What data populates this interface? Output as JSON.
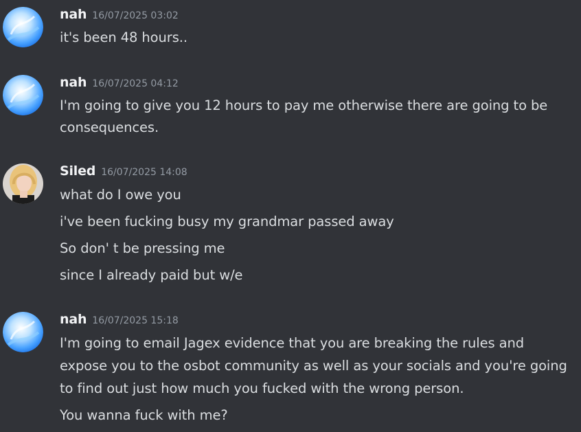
{
  "messages": [
    {
      "author": "nah",
      "timestamp": "16/07/2025 03:02",
      "avatar": "blue-swirl-avatar",
      "lines": [
        "it's been 48 hours.."
      ]
    },
    {
      "author": "nah",
      "timestamp": "16/07/2025 04:12",
      "avatar": "blue-swirl-avatar",
      "lines": [
        "I'm going to give you 12 hours to pay me otherwise there are going to be consequences."
      ]
    },
    {
      "author": "Siled",
      "timestamp": "16/07/2025 14:08",
      "avatar": "portrait-avatar",
      "lines": [
        "what do I owe you",
        "i've been fucking busy my grandmar passed away",
        "So don' t be pressing me",
        "since I already paid but w/e"
      ]
    },
    {
      "author": "nah",
      "timestamp": "16/07/2025 15:18",
      "avatar": "blue-swirl-avatar",
      "lines": [
        "I'm going to email Jagex evidence that you are breaking the rules and expose you to the osbot community as well as your socials and you're going to find out just how much you fucked with the wrong person.",
        "You wanna fuck with me?"
      ]
    }
  ],
  "colors": {
    "background": "#313338",
    "author": "#f2f3f5",
    "timestamp": "#949ba4",
    "message_text": "#dbdee1"
  }
}
